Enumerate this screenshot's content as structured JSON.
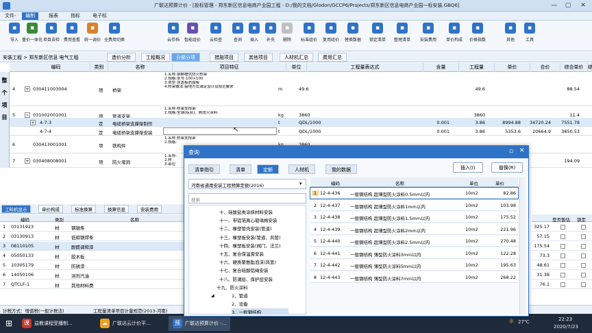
{
  "window": {
    "title": "广联达预算计价 - [投标管理 - 郑东新区信息电商产业园工程 - D:/我的文档/Glodon/GCCP6/Projects/郑东新区信息电商产业园一标安装.GBQ6]",
    "controls": [
      "—",
      "▢",
      "✕"
    ]
  },
  "menu": [
    "文件-",
    "编制",
    "报表",
    "指标",
    "电子标"
  ],
  "ribbon": [
    {
      "label": "导入",
      "icon": "import-icon",
      "color": "#2f73c7"
    },
    {
      "label": "量价一体化",
      "icon": "link-icon",
      "color": "#3a8a3a"
    },
    {
      "label": "项目自检",
      "icon": "check-icon",
      "color": "#2f73c7"
    },
    {
      "label": "费用查看",
      "icon": "view-icon",
      "color": "#2f73c7"
    },
    {
      "label": "统一调价",
      "icon": "adjust-icon",
      "color": "#d9822b"
    },
    {
      "label": "全费用切换",
      "icon": "switch-icon",
      "color": "#2f73c7"
    },
    {
      "label": "云存档",
      "icon": "cloud-save-icon",
      "color": "#2f73c7"
    },
    {
      "label": "智能组价",
      "icon": "smart-icon",
      "color": "#6a4fb3"
    },
    {
      "label": "云检查",
      "icon": "cloud-check-icon",
      "color": "#2f73c7"
    },
    {
      "label": "查询",
      "icon": "search-icon",
      "color": "#2f73c7"
    },
    {
      "label": "插入",
      "icon": "insert-icon",
      "color": "#2f73c7"
    },
    {
      "label": "补充",
      "icon": "add-icon",
      "color": "#2f73c7"
    },
    {
      "label": "删除",
      "icon": "delete-icon",
      "color": "#c0c0c0"
    },
    {
      "label": "标准组价",
      "icon": "standard-icon",
      "color": "#2f73c7"
    },
    {
      "label": "复用组价",
      "icon": "reuse-icon",
      "color": "#2f73c7"
    },
    {
      "label": "替换数据",
      "icon": "replace-icon",
      "color": "#2f73c7"
    },
    {
      "label": "锁定清单",
      "icon": "lock-icon",
      "color": "#2f73c7"
    },
    {
      "label": "整理清单",
      "icon": "sort-icon",
      "color": "#2f73c7"
    },
    {
      "label": "安装费用",
      "icon": "install-icon",
      "color": "#2f73c7"
    },
    {
      "label": "单价构成",
      "icon": "price-icon",
      "color": "#2f73c7"
    },
    {
      "label": "价格指数",
      "icon": "index-icon",
      "color": "#2f73c7"
    },
    {
      "label": "其他",
      "icon": "other-icon",
      "color": "#2f73c7"
    },
    {
      "label": "工具",
      "icon": "tool-icon",
      "color": "#2f73c7"
    }
  ],
  "context": {
    "breadcrumb": "安装工程 > 郑东新区信息 电气工程",
    "tabs": [
      "造价分析",
      "工程概况",
      "分部分项",
      "措施项目",
      "其他项目",
      "人材机汇总",
      "费用汇总"
    ],
    "active_tab": "分部分项"
  },
  "grid": {
    "side_label": [
      "整",
      "个",
      "项",
      "目"
    ],
    "columns": [
      "编码",
      "类别",
      "名称",
      "项目特征",
      "单位",
      "工程量表达式",
      "含量",
      "工程量",
      "单价",
      "合价",
      "综合单价",
      "综"
    ],
    "rows": [
      {
        "no": "4",
        "expander": "+",
        "code": "030411003004",
        "type": "项",
        "name": "桥架",
        "features": [
          "1.名称:钢制槽式防火桥架",
          "2.规格:型号:100×100",
          "3.类型:含盖板防腐板",
          "4.桥架做法:接地方式满足设计及规范要求"
        ],
        "unit": "m",
        "expr": "49.6",
        "content": "",
        "qty": "49.6",
        "price": "",
        "total": "",
        "comp": "88.54"
      },
      {
        "no": "5",
        "expander": "−",
        "code": "031002001001",
        "type": "项",
        "name": "管道支架",
        "features": [
          "1.名称:桥架支撑架",
          "2.规格:型钢(综合)、刷防火涂料"
        ],
        "unit": "kg",
        "expr": "3860",
        "content": "",
        "qty": "3860",
        "price": "",
        "total": "",
        "comp": "11.4"
      },
      {
        "no": "",
        "expander": "+",
        "code": "4-7-3",
        "type": "定",
        "name": "电缆桥架支撑架制作",
        "features": [],
        "unit": "t",
        "expr": "QDL/1000",
        "content": "0.001",
        "qty": "3.86",
        "price": "8994.88",
        "total": "34720.24",
        "comp": "7551.78"
      },
      {
        "no": "",
        "expander": "",
        "code": "4-7-4",
        "type": "定",
        "name": "电缆桥架支撑架安装",
        "features": [],
        "unit": "t",
        "expr": "QDL/1000",
        "content": "0.001",
        "qty": "3.86",
        "price": "5353.6",
        "total": "20664.9",
        "comp": "3850.53"
      },
      {
        "no": "6",
        "expander": "",
        "code": "030413001001",
        "type": "项",
        "name": "铁构件",
        "features": [
          "1.名称:桥架支撑架",
          "2.规格:"
        ],
        "unit": "kg",
        "expr": "3860",
        "content": "",
        "qty": "",
        "price": "",
        "total": "",
        "comp": ""
      },
      {
        "no": "7",
        "expander": "+",
        "code": "030408008001",
        "type": "项",
        "name": "防火堵洞",
        "features": [
          "1.名称:",
          "2.材",
          "3.部位"
        ],
        "unit": "",
        "expr": "",
        "content": "",
        "qty": "",
        "price": "",
        "total": "",
        "comp": "194.09"
      }
    ]
  },
  "lower": {
    "tabs": [
      "工料机显示",
      "单价构成",
      "标准换算",
      "换算信息",
      "安装费用"
    ],
    "active_tab": "工料机显示",
    "columns": [
      "编码",
      "类别",
      "名称"
    ],
    "rows": [
      {
        "no": "1",
        "code": "03131923",
        "type": "材",
        "name": "钢锯条"
      },
      {
        "no": "2",
        "code": "03130913",
        "type": "材",
        "name": "低碳钢焊条"
      },
      {
        "no": "3",
        "code": "08110105",
        "type": "材",
        "name": "酚醛调和漆"
      },
      {
        "no": "4",
        "code": "05050133",
        "type": "材",
        "name": "胶木板"
      },
      {
        "no": "5",
        "code": "10305179",
        "type": "材",
        "name": "防锈漆"
      },
      {
        "no": "6",
        "code": "14050106",
        "type": "材",
        "name": "溶剂汽油"
      },
      {
        "no": "7",
        "code": "QTCLF-1",
        "type": "材",
        "name": "其他材料费"
      }
    ],
    "right_columns": [
      "是否暂估",
      "锁定"
    ],
    "right_values": [
      "325.17",
      "57.15",
      "175.54",
      "73.3",
      "48.61",
      "31.38",
      "76.1"
    ]
  },
  "status": {
    "tax": "计税方式：增值税(一般计税法)",
    "standard": "工程量清单项目计量规范(2013-河南)"
  },
  "dialog": {
    "title": "查询",
    "tabs": [
      "清单指引",
      "清单",
      "定额",
      "人材机",
      "我的数据"
    ],
    "active_tab": "定额",
    "insert_button": "插入(I)",
    "replace_button": "替换(R)",
    "library": "河南省通用安装工程预算定额(2016)",
    "search_placeholder": "搜索",
    "tree": [
      "十、硅酸盐类涂抹材料安装",
      "十一、带铝箔离心玻璃棉安装",
      "十二、橡塑管壳安装(管道)",
      "十三、橡塑板安装(管道、风管)",
      "十四、橡塑板安装(阀门、法兰)",
      "十五、复合保温膏安装",
      "十六、硬质聚氨酯泡沫(风管)",
      "十七、复合硅酸铝绳安装",
      "十八、防潮层、保护层安装",
      "十九、防火涂料",
      "1、管道",
      "2、设备",
      "3、一般钢结构"
    ],
    "columns": [
      "编码",
      "名称",
      "单位",
      "单价"
    ],
    "rows": [
      {
        "no": "1",
        "code": "12-4-436",
        "name": "一般钢结构 超薄型防火涂料0.5mm以内",
        "unit": "10m2",
        "price": "82.86"
      },
      {
        "no": "2",
        "code": "12-4-437",
        "name": "一般钢结构 超薄型防火涂料1mm以内",
        "unit": "10m2",
        "price": "103.98"
      },
      {
        "no": "3",
        "code": "12-4-438",
        "name": "一般钢结构 超薄型防火涂料1.5mm以内",
        "unit": "10m2",
        "price": "175.52"
      },
      {
        "no": "4",
        "code": "12-4-439",
        "name": "一般钢结构 超薄型防火涂料2mm以内",
        "unit": "10m2",
        "price": "221.96"
      },
      {
        "no": "5",
        "code": "12-4-440",
        "name": "一般钢结构 超薄型防火涂料2.5mm以内",
        "unit": "10m2",
        "price": "270.48"
      },
      {
        "no": "6",
        "code": "12-4-441",
        "name": "一般钢结构 薄型防火涂料3mm以内",
        "unit": "10m2",
        "price": "122.28"
      },
      {
        "no": "7",
        "code": "12-4-442",
        "name": "一般钢结构 薄型防火涂料5mm以内",
        "unit": "10m2",
        "price": "195.63"
      },
      {
        "no": "8",
        "code": "12-4-443",
        "name": "一般钢结构 薄型防火涂料7mm以内",
        "unit": "10m2",
        "price": "268.22"
      }
    ]
  },
  "taskbar": {
    "apps": [
      {
        "label": "益教课程受播制...",
        "icon": "video-app-icon",
        "color": "#c0392b",
        "glyph": "课"
      },
      {
        "label": "广联达云计价平...",
        "icon": "glodon-cloud-icon",
        "color": "#f0a020",
        "glyph": "☁"
      },
      {
        "label": "广联达预算计价 -...",
        "icon": "glodon-budget-icon",
        "color": "#2f73c7",
        "glyph": "预"
      }
    ],
    "weather": "27℃",
    "time": "22:23",
    "date": "2020/7/23"
  }
}
